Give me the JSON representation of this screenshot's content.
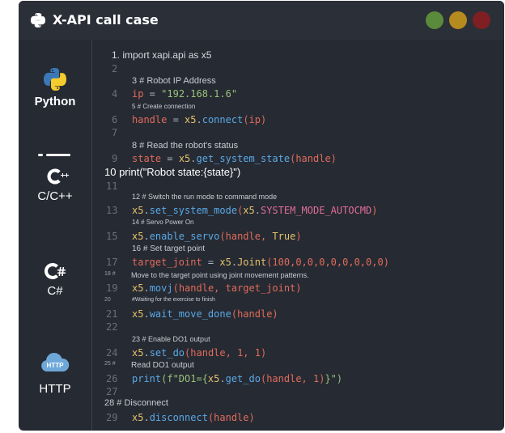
{
  "window": {
    "title": "X-API call case",
    "title_icon": "python-icon",
    "controls": {
      "green": "#5a8a3c",
      "yellow": "#b58a1e",
      "red": "#7f1f24"
    }
  },
  "sidebar": {
    "items": [
      {
        "label": "Python",
        "icon": "python-logo-icon",
        "active": true
      },
      {
        "label": "C/C++",
        "icon": "cpp-logo-icon",
        "active": false
      },
      {
        "label": "C#",
        "icon": "csharp-logo-icon",
        "active": false
      },
      {
        "label": "HTTP",
        "icon": "http-cloud-icon",
        "badge": "HTTP",
        "active": false
      }
    ]
  },
  "code": {
    "lines": {
      "l1": "1. import xapi.api as x5",
      "l2": "2",
      "l3": "3 # Robot IP Address",
      "l4n": "4",
      "l5": "5 # Create connection",
      "l6n": "6",
      "l7": "7",
      "l8": "8 # Read the robot's status",
      "l9n": "9",
      "l10": "10 print(\"Robot state:{state}\")",
      "l11": "11",
      "l12": "12 # Switch the run mode to command mode",
      "l13n": "13",
      "l14": "14 # Servo Power On",
      "l15n": "15",
      "l16": "16 # Set target point",
      "l17n": "17",
      "l18n": "18 #",
      "l18t": "Move to the target point using joint movement patterns.",
      "l19n": "19",
      "l20n": "20",
      "l20t": "#Waiting for the exercise to finish",
      "l21n": "21",
      "l22": "22",
      "l23": "23 # Enable DO1 output",
      "l24n": "24",
      "l25n": "25 #",
      "l25t": "Read DO1 output",
      "l26n": "26",
      "l27": "27",
      "l28": "28 # Disconnect",
      "l29n": "29"
    },
    "tokens": {
      "ip": "ip",
      "eq": " = ",
      "ipval": "\"192.168.1.6\"",
      "handle": "handle",
      "x5": "x5",
      "dot": ".",
      "connect": "connect",
      "ipargs": "(ip)",
      "state": "state",
      "get_system_state": "get_system_state",
      "handlearg": "(handle)",
      "set_system_mode": "set_system_mode",
      "lp": "(",
      "mode": "SYSTEM_MODE_AUTOCMD",
      "rp": ")",
      "enable_servo": "enable_servo",
      "handle_true": "(handle, ",
      "true": "True",
      "target_joint": "target_joint",
      "Joint": "Joint",
      "jointargs": "(100,0,0,0,0,0,0,0,0)",
      "movj": "movj",
      "movjargs": "(handle, target_joint)",
      "wait_move_done": "wait_move_done",
      "set_do": "set_do",
      "setdoargs": "(handle, 1, 1)",
      "print": "print",
      "fstr1": "(f\"DO1={",
      "get_do": "get_do",
      "getdoargs": "(handle, 1)",
      "fstr2": "}\")",
      "disconnect": "disconnect"
    }
  }
}
